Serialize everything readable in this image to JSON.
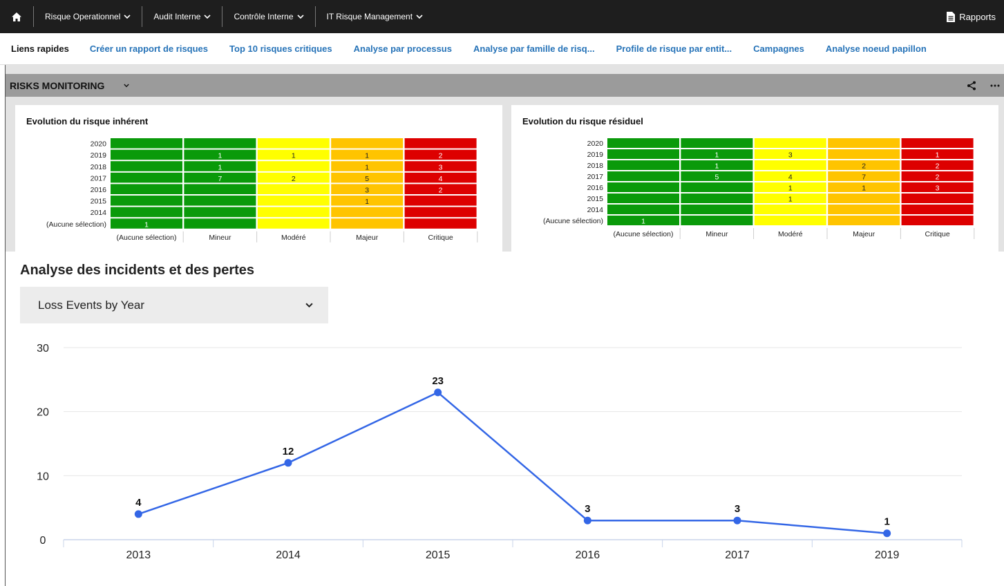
{
  "topnav": {
    "items": [
      {
        "label": "Risque Operationnel"
      },
      {
        "label": "Audit Interne"
      },
      {
        "label": "Contrôle Interne"
      },
      {
        "label": "IT Risque Management"
      }
    ],
    "rapports": "Rapports"
  },
  "quicklinks": {
    "title": "Liens rapides",
    "links": [
      "Créer un rapport de risques",
      "Top 10 risques critiques",
      "Analyse par processus",
      "Analyse par famille de risq...",
      "Profile de risque par entit...",
      "Campagnes",
      "Analyse noeud papillon"
    ]
  },
  "section": {
    "title": "RISKS MONITORING"
  },
  "heatmaps": [
    {
      "title": "Evolution du risque inhérent",
      "rows": [
        "2020",
        "2019",
        "2018",
        "2017",
        "2016",
        "2015",
        "2014",
        "(Aucune sélection)"
      ],
      "cols": [
        "(Aucune sélection)",
        "Mineur",
        "Modéré",
        "Majeur",
        "Critique"
      ],
      "values": [
        [
          "",
          "",
          "",
          "",
          ""
        ],
        [
          "",
          "1",
          "1",
          "1",
          "2"
        ],
        [
          "",
          "1",
          "",
          "1",
          "3"
        ],
        [
          "",
          "7",
          "2",
          "5",
          "4"
        ],
        [
          "",
          "",
          "",
          "3",
          "2"
        ],
        [
          "",
          "",
          "",
          "1",
          ""
        ],
        [
          "",
          "",
          "",
          "",
          ""
        ],
        [
          "1",
          "",
          "",
          "",
          ""
        ]
      ]
    },
    {
      "title": "Evolution du risque résiduel",
      "rows": [
        "2020",
        "2019",
        "2018",
        "2017",
        "2016",
        "2015",
        "2014",
        "(Aucune sélection)"
      ],
      "cols": [
        "(Aucune sélection)",
        "Mineur",
        "Modéré",
        "Majeur",
        "Critique"
      ],
      "values": [
        [
          "",
          "",
          "",
          "",
          ""
        ],
        [
          "",
          "1",
          "3",
          "",
          "1"
        ],
        [
          "",
          "1",
          "",
          "2",
          "2"
        ],
        [
          "",
          "5",
          "4",
          "7",
          "2"
        ],
        [
          "",
          "",
          "1",
          "1",
          "3"
        ],
        [
          "",
          "",
          "1",
          "",
          ""
        ],
        [
          "",
          "",
          "",
          "",
          ""
        ],
        [
          "1",
          "",
          "",
          "",
          ""
        ]
      ]
    }
  ],
  "heat_colors": [
    "#0a9a0a",
    "#0a9a0a",
    "#ffff00",
    "#ffc400",
    "#dd0000"
  ],
  "incidents": {
    "title": "Analyse des incidents et des pertes",
    "dropdown_value": "Loss Events by Year"
  },
  "chart_data": {
    "type": "line",
    "categories": [
      "2013",
      "2014",
      "2015",
      "2016",
      "2017",
      "2019"
    ],
    "values": [
      4,
      12,
      23,
      3,
      3,
      1
    ],
    "yticks": [
      0,
      10,
      20,
      30
    ],
    "ylim": [
      0,
      30
    ],
    "color": "#3366e6"
  }
}
